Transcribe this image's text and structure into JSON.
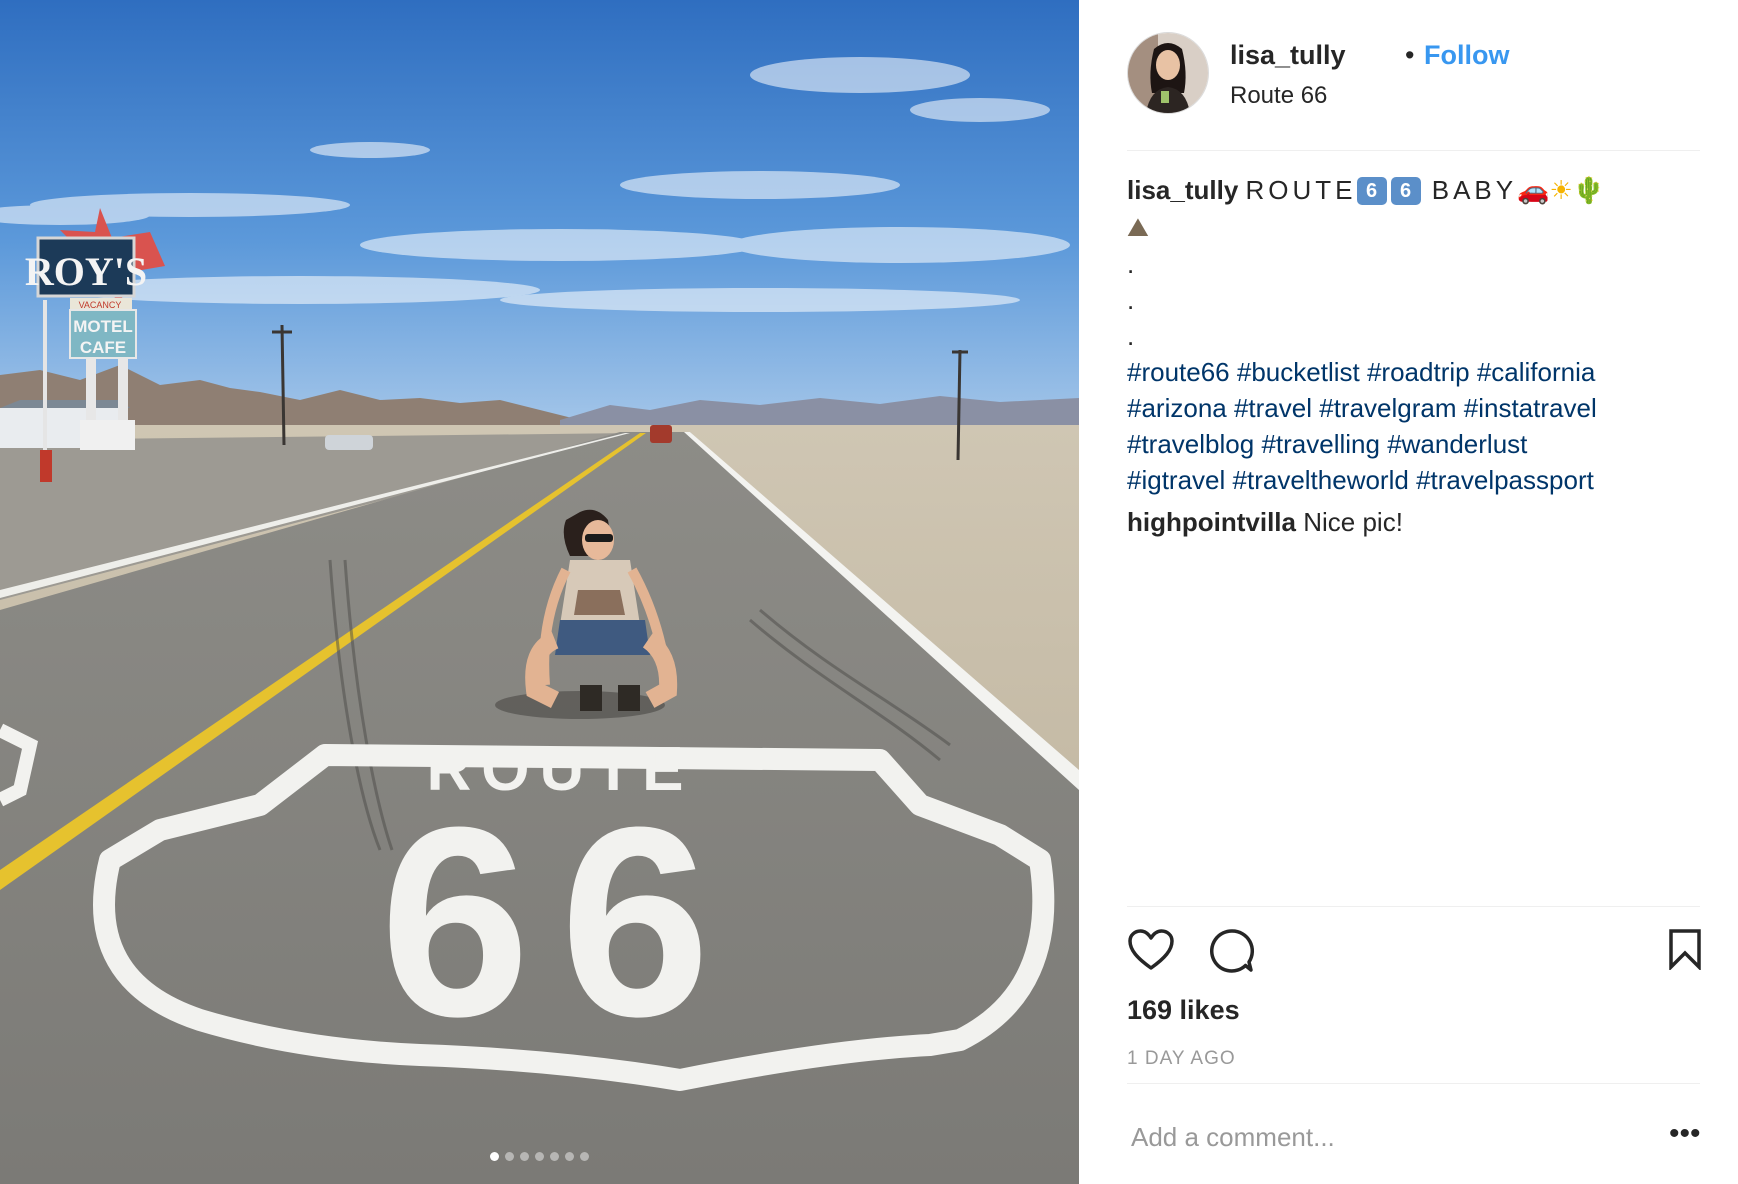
{
  "post": {
    "username": "lisa_tully",
    "separator": "•",
    "follow_label": "Follow",
    "location": "Route 66",
    "photo_sign_top": "ROY'S",
    "photo_sign_vacancy": "VACANCY",
    "photo_sign_motel": "MOTEL",
    "photo_sign_cafe": "CAFE",
    "road_marking_word": "ROUTE",
    "road_marking_number": "66",
    "carousel_dots": 7,
    "carousel_active_index": 0
  },
  "caption": {
    "username": "lisa_tully",
    "text_part1": "ROUTE",
    "keycap1": "6",
    "keycap2": "6",
    "text_part2": "BABY",
    "emoji_car": "🚗",
    "emoji_sun": "☀",
    "emoji_cactus": "🌵",
    "emoji_mountain": "⛰",
    "dot1": ".",
    "dot2": ".",
    "dot3": ".",
    "hashtags": [
      "#route66",
      "#bucketlist",
      "#roadtrip",
      "#california",
      "#arizona",
      "#travel",
      "#travelgram",
      "#instatravel",
      "#travelblog",
      "#travelling",
      "#wanderlust",
      "#igtravel",
      "#traveltheworld",
      "#travelpassport"
    ]
  },
  "comment": {
    "username": "highpointvilla",
    "text": "Nice pic!"
  },
  "actions": {
    "like_icon": "heart-icon",
    "comment_icon": "comment-bubble-icon",
    "save_icon": "bookmark-icon"
  },
  "likes_label": "169 likes",
  "timestamp": "1 DAY AGO",
  "add_comment_placeholder": "Add a comment...",
  "more_label": "•••",
  "colors": {
    "link_blue": "#3897f0",
    "hashtag": "#003569",
    "text": "#262626",
    "muted": "#999999",
    "divider": "#efefef"
  }
}
